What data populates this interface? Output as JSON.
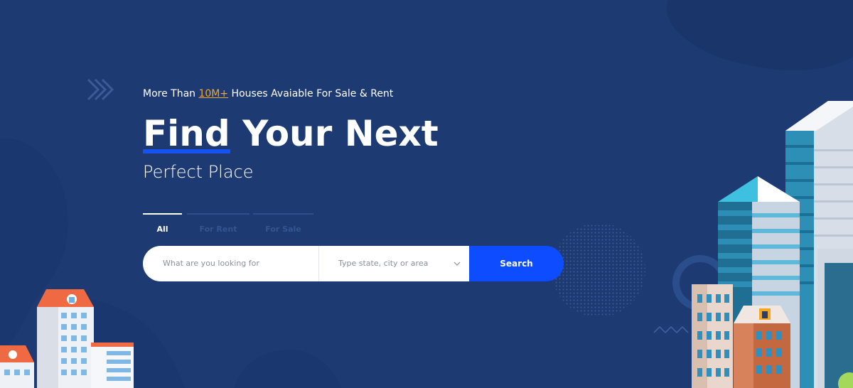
{
  "hero": {
    "tagline_prefix": "More Than ",
    "tagline_highlight": "10M+",
    "tagline_suffix": " Houses Avaiable For Sale & Rent",
    "title_word1": "Find",
    "title_rest": " Your Next",
    "subtitle": "Perfect Place"
  },
  "tabs": [
    {
      "label": "All",
      "active": true
    },
    {
      "label": "For Rent",
      "active": false
    },
    {
      "label": "For Sale",
      "active": false
    }
  ],
  "search": {
    "keyword_placeholder": "What are you looking for",
    "location_placeholder": "Type state, city or area",
    "button_label": "Search"
  },
  "colors": {
    "background": "#1d3a72",
    "accent": "#0d4cff",
    "highlight": "#f5a623"
  },
  "icons": [
    "arrows-pattern-icon",
    "chevron-down-icon"
  ]
}
